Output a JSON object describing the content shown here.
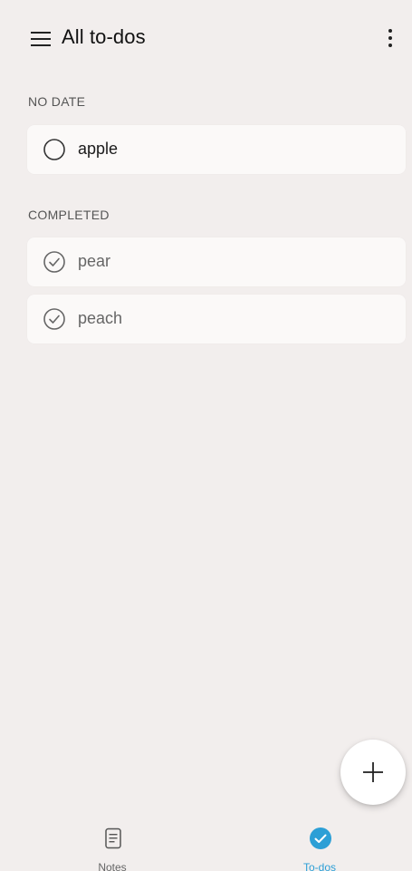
{
  "header": {
    "title": "All to-dos"
  },
  "sections": {
    "no_date": {
      "label": "NO DATE",
      "items": [
        {
          "text": "apple",
          "completed": false
        }
      ]
    },
    "completed": {
      "label": "COMPLETED",
      "items": [
        {
          "text": "pear",
          "completed": true
        },
        {
          "text": "peach",
          "completed": true
        }
      ]
    }
  },
  "bottom_nav": {
    "notes_label": "Notes",
    "todos_label": "To-dos"
  },
  "colors": {
    "background": "#f2eeed",
    "card": "#fbf9f8",
    "accent": "#2c9fd6"
  },
  "icons": {
    "menu": "hamburger-menu-icon",
    "more": "more-vertical-icon",
    "unchecked": "empty-circle-icon",
    "checked": "circle-check-icon",
    "add": "plus-icon",
    "notes": "note-document-icon",
    "todos": "checkmark-circle-filled-icon"
  }
}
